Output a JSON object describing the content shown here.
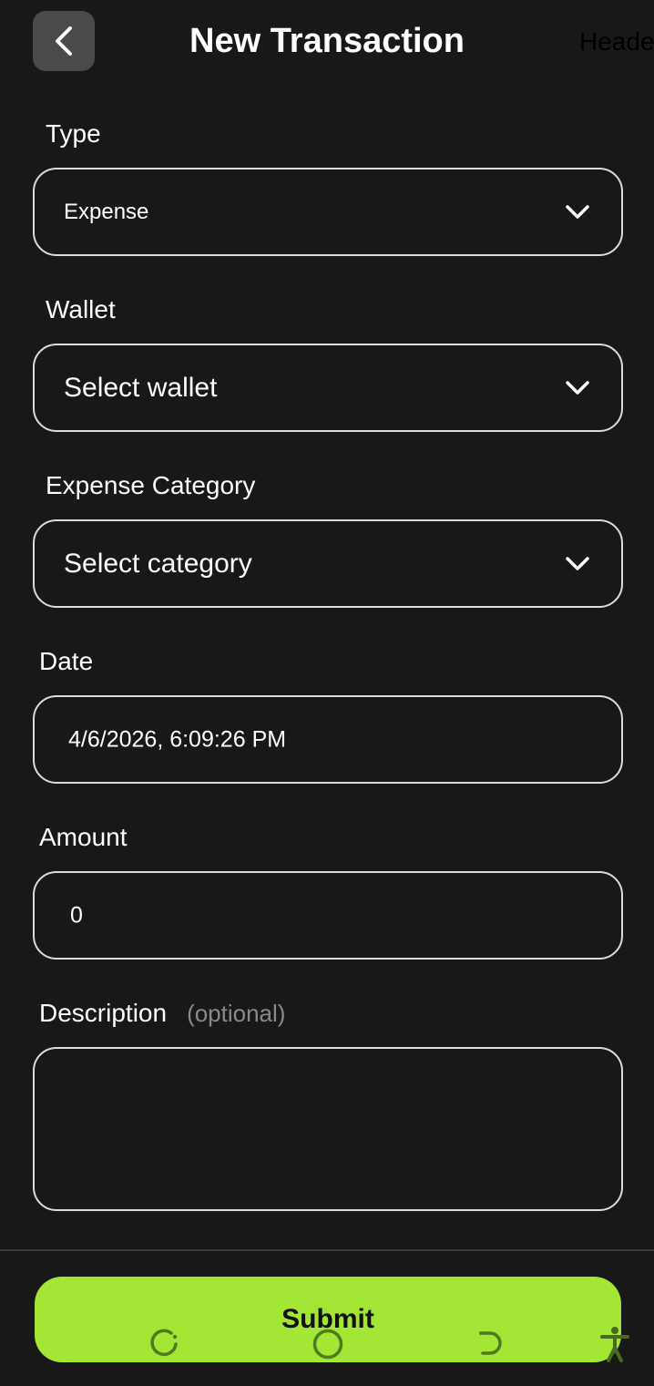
{
  "header": {
    "title": "New Transaction",
    "overflow_text": "Heade"
  },
  "form": {
    "type": {
      "label": "Type",
      "value": "Expense"
    },
    "wallet": {
      "label": "Wallet",
      "placeholder": "Select wallet"
    },
    "category": {
      "label": "Expense Category",
      "placeholder": "Select category"
    },
    "date": {
      "label": "Date",
      "value": "4/6/2026, 6:09:26 PM"
    },
    "amount": {
      "label": "Amount",
      "value": "0"
    },
    "description": {
      "label": "Description",
      "optional_hint": "(optional)",
      "value": ""
    }
  },
  "submit": {
    "label": "Submit"
  },
  "colors": {
    "background": "#181818",
    "accent": "#a4e635",
    "border": "#dcdcdc",
    "back_button": "#4a4a4a"
  },
  "icons": {
    "back": "chevron-left-icon",
    "dropdown": "chevron-down-icon",
    "nav_recents": "recents-icon",
    "nav_home": "home-icon",
    "nav_back": "back-gesture-icon",
    "nav_accessibility": "accessibility-icon"
  }
}
